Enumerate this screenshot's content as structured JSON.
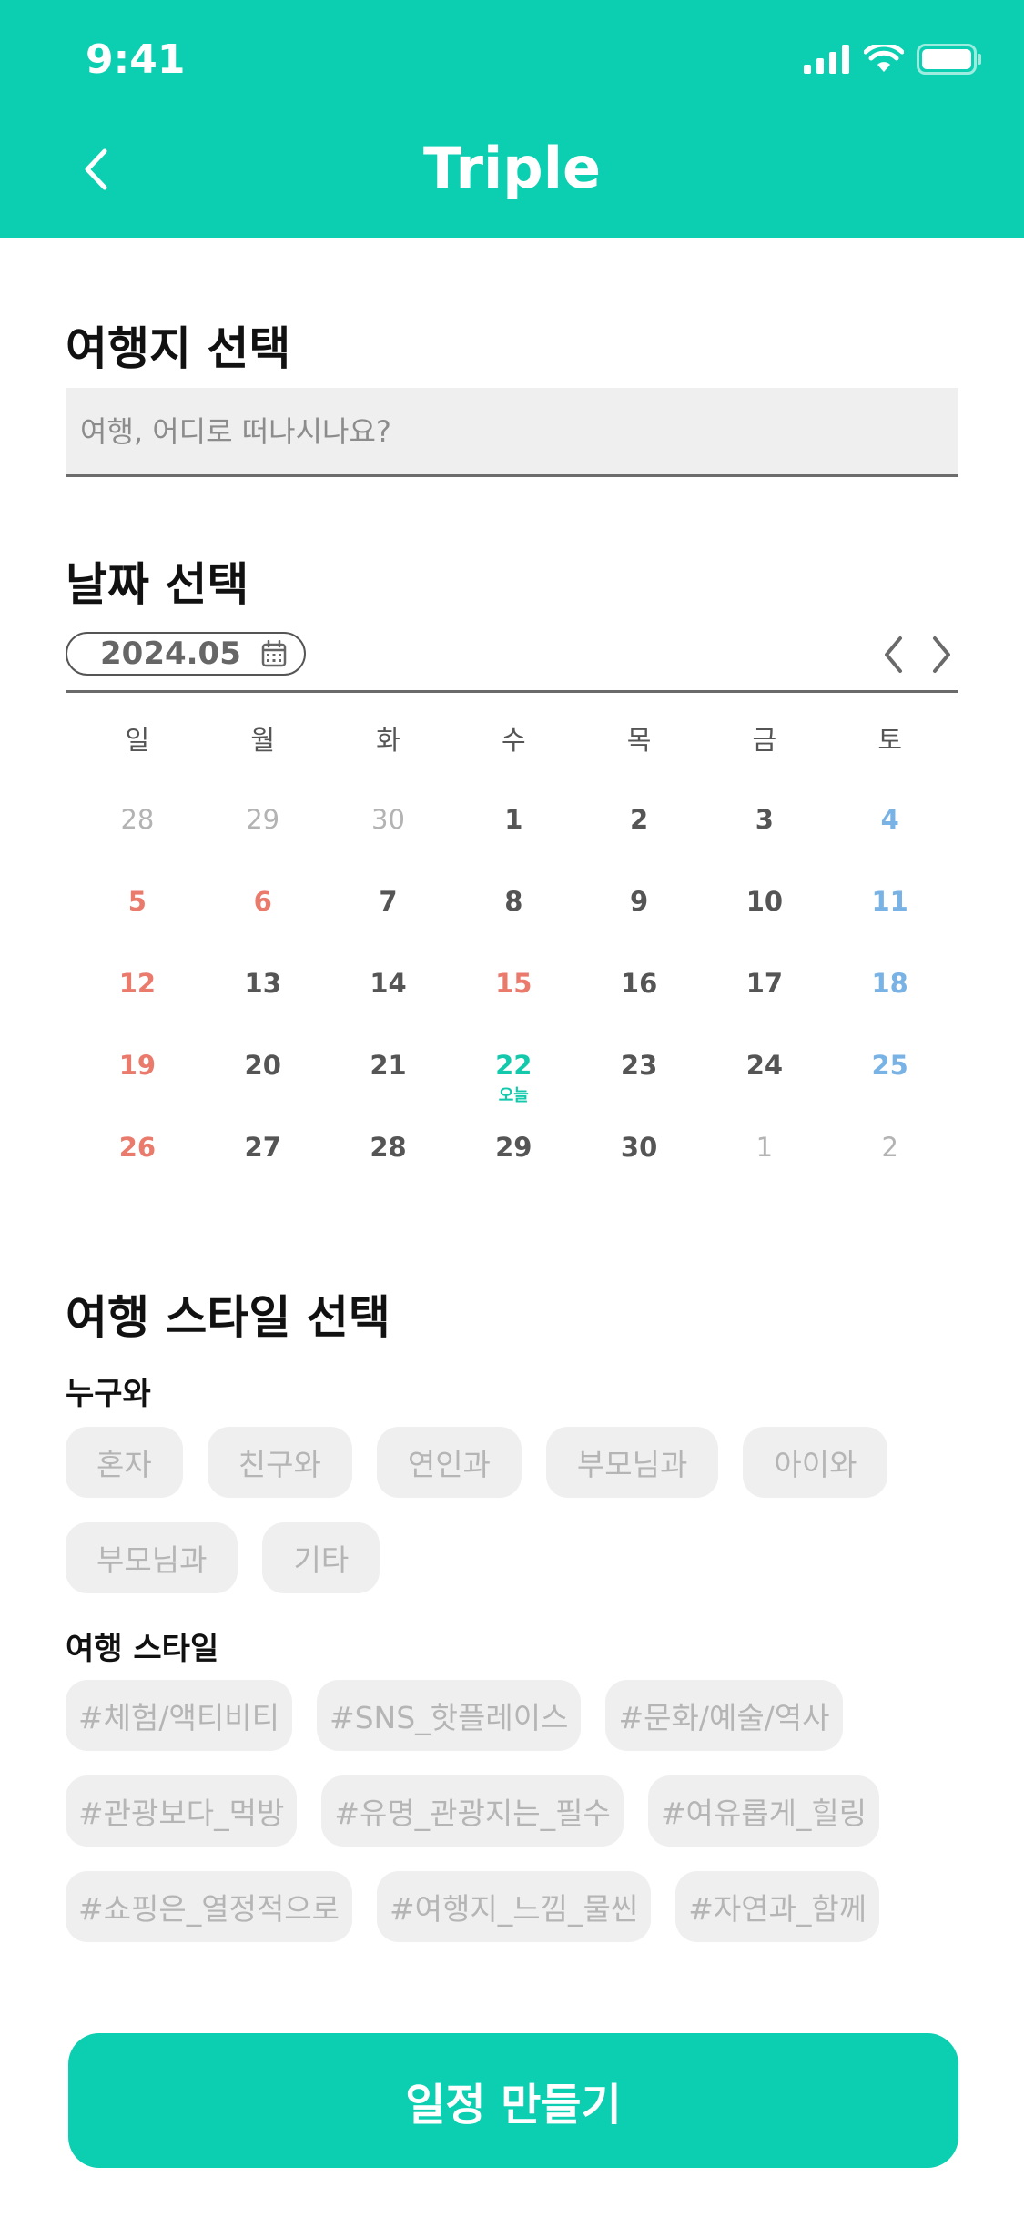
{
  "status_bar": {
    "time": "9:41"
  },
  "header": {
    "title": "Triple"
  },
  "destination": {
    "title": "여행지 선택",
    "placeholder": "여행, 어디로 떠나시나요?"
  },
  "date": {
    "title": "날짜 선택",
    "month": "2024.05",
    "weekdays": [
      "일",
      "월",
      "화",
      "수",
      "목",
      "금",
      "토"
    ],
    "today_label": "오늘",
    "days": [
      {
        "d": "28",
        "k": "other"
      },
      {
        "d": "29",
        "k": "other"
      },
      {
        "d": "30",
        "k": "other"
      },
      {
        "d": "1",
        "k": ""
      },
      {
        "d": "2",
        "k": ""
      },
      {
        "d": "3",
        "k": ""
      },
      {
        "d": "4",
        "k": "sat"
      },
      {
        "d": "5",
        "k": "sun"
      },
      {
        "d": "6",
        "k": "sun"
      },
      {
        "d": "7",
        "k": ""
      },
      {
        "d": "8",
        "k": ""
      },
      {
        "d": "9",
        "k": ""
      },
      {
        "d": "10",
        "k": ""
      },
      {
        "d": "11",
        "k": "sat"
      },
      {
        "d": "12",
        "k": "sun"
      },
      {
        "d": "13",
        "k": ""
      },
      {
        "d": "14",
        "k": ""
      },
      {
        "d": "15",
        "k": "sun"
      },
      {
        "d": "16",
        "k": ""
      },
      {
        "d": "17",
        "k": ""
      },
      {
        "d": "18",
        "k": "sat"
      },
      {
        "d": "19",
        "k": "sun"
      },
      {
        "d": "20",
        "k": ""
      },
      {
        "d": "21",
        "k": ""
      },
      {
        "d": "22",
        "k": "today"
      },
      {
        "d": "23",
        "k": ""
      },
      {
        "d": "24",
        "k": ""
      },
      {
        "d": "25",
        "k": "sat"
      },
      {
        "d": "26",
        "k": "sun"
      },
      {
        "d": "27",
        "k": ""
      },
      {
        "d": "28",
        "k": ""
      },
      {
        "d": "29",
        "k": ""
      },
      {
        "d": "30",
        "k": ""
      },
      {
        "d": "1",
        "k": "other"
      },
      {
        "d": "2",
        "k": "other"
      }
    ]
  },
  "style": {
    "title": "여행 스타일 선택",
    "companion_title": "누구와",
    "companions": [
      "혼자",
      "친구와",
      "연인과",
      "부모님과",
      "아이와",
      "부모님과",
      "기타"
    ],
    "style_title": "여행 스타일",
    "tags": [
      "#체험/액티비티",
      "#SNS_핫플레이스",
      "#문화/예술/역사",
      "#관광보다_먹방",
      "#유명_관광지는_필수",
      "#여유롭게_힐링",
      "#쇼핑은_열정적으로",
      "#여행지_느낌_물씬",
      "#자연과_함께"
    ]
  },
  "cta": {
    "label": "일정 만들기"
  },
  "colors": {
    "brand": "#0ccfb2",
    "sunday": "#ea7a6c",
    "saturday": "#79b3e6",
    "chip_bg": "#efefef",
    "chip_text": "#b5b5b5"
  }
}
